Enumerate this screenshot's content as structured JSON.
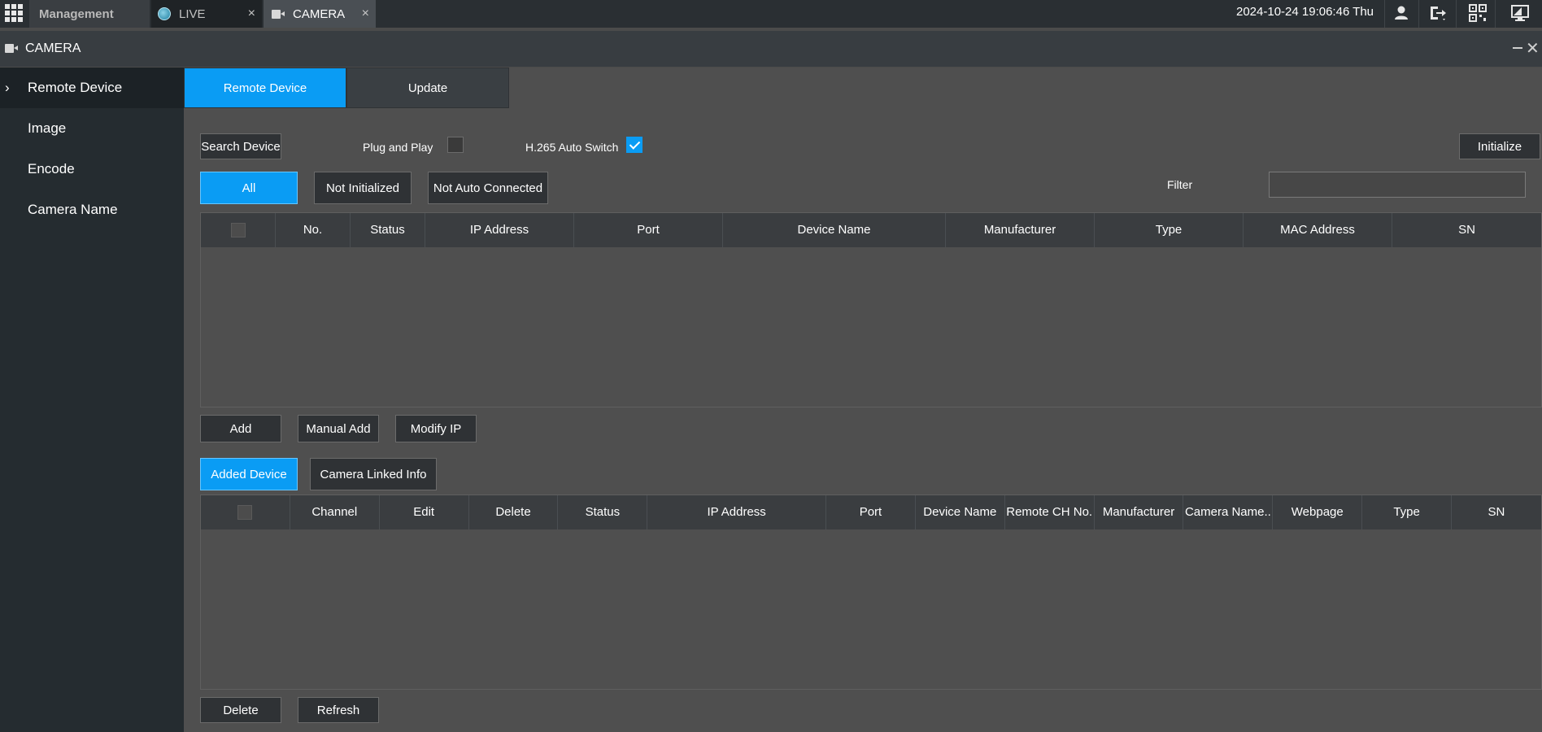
{
  "topbar": {
    "tabs": [
      {
        "label": "Management"
      },
      {
        "label": "LIVE",
        "close": "×"
      },
      {
        "label": "CAMERA",
        "close": "×"
      }
    ],
    "datetime": "2024-10-24 19:06:46 Thu"
  },
  "window": {
    "title": "CAMERA"
  },
  "sidebar": {
    "items": [
      {
        "label": "Remote Device"
      },
      {
        "label": "Image"
      },
      {
        "label": "Encode"
      },
      {
        "label": "Camera Name"
      }
    ],
    "active_chevron": "›"
  },
  "subtabs": [
    {
      "label": "Remote Device"
    },
    {
      "label": "Update"
    }
  ],
  "search": {
    "search_button": "Search Device",
    "plug_and_play_label": "Plug and Play",
    "plug_and_play_checked": false,
    "h265_label": "H.265 Auto Switch",
    "h265_checked": true,
    "initialize_button": "Initialize"
  },
  "filters": {
    "buttons": [
      {
        "label": "All"
      },
      {
        "label": "Not Initialized"
      },
      {
        "label": "Not Auto Connected"
      }
    ],
    "filter_label": "Filter",
    "filter_value": ""
  },
  "search_table": {
    "columns": [
      "No.",
      "Status",
      "IP Address",
      "Port",
      "Device Name",
      "Manufacturer",
      "Type",
      "MAC Address",
      "SN"
    ]
  },
  "search_actions": {
    "add": "Add",
    "manual_add": "Manual Add",
    "modify_ip": "Modify IP"
  },
  "added_tabs": [
    {
      "label": "Added Device"
    },
    {
      "label": "Camera Linked Info"
    }
  ],
  "added_table": {
    "columns": [
      "Channel",
      "Edit",
      "Delete",
      "Status",
      "IP Address",
      "Port",
      "Device Name",
      "Remote CH No.",
      "Manufacturer",
      "Camera Name..",
      "Webpage",
      "Type",
      "SN"
    ]
  },
  "added_actions": {
    "delete": "Delete",
    "refresh": "Refresh"
  },
  "colors": {
    "accent": "#0a9cf4",
    "topbar": "#2a2f33",
    "sidebar": "#252c30",
    "panel": "#4f4f4f"
  }
}
